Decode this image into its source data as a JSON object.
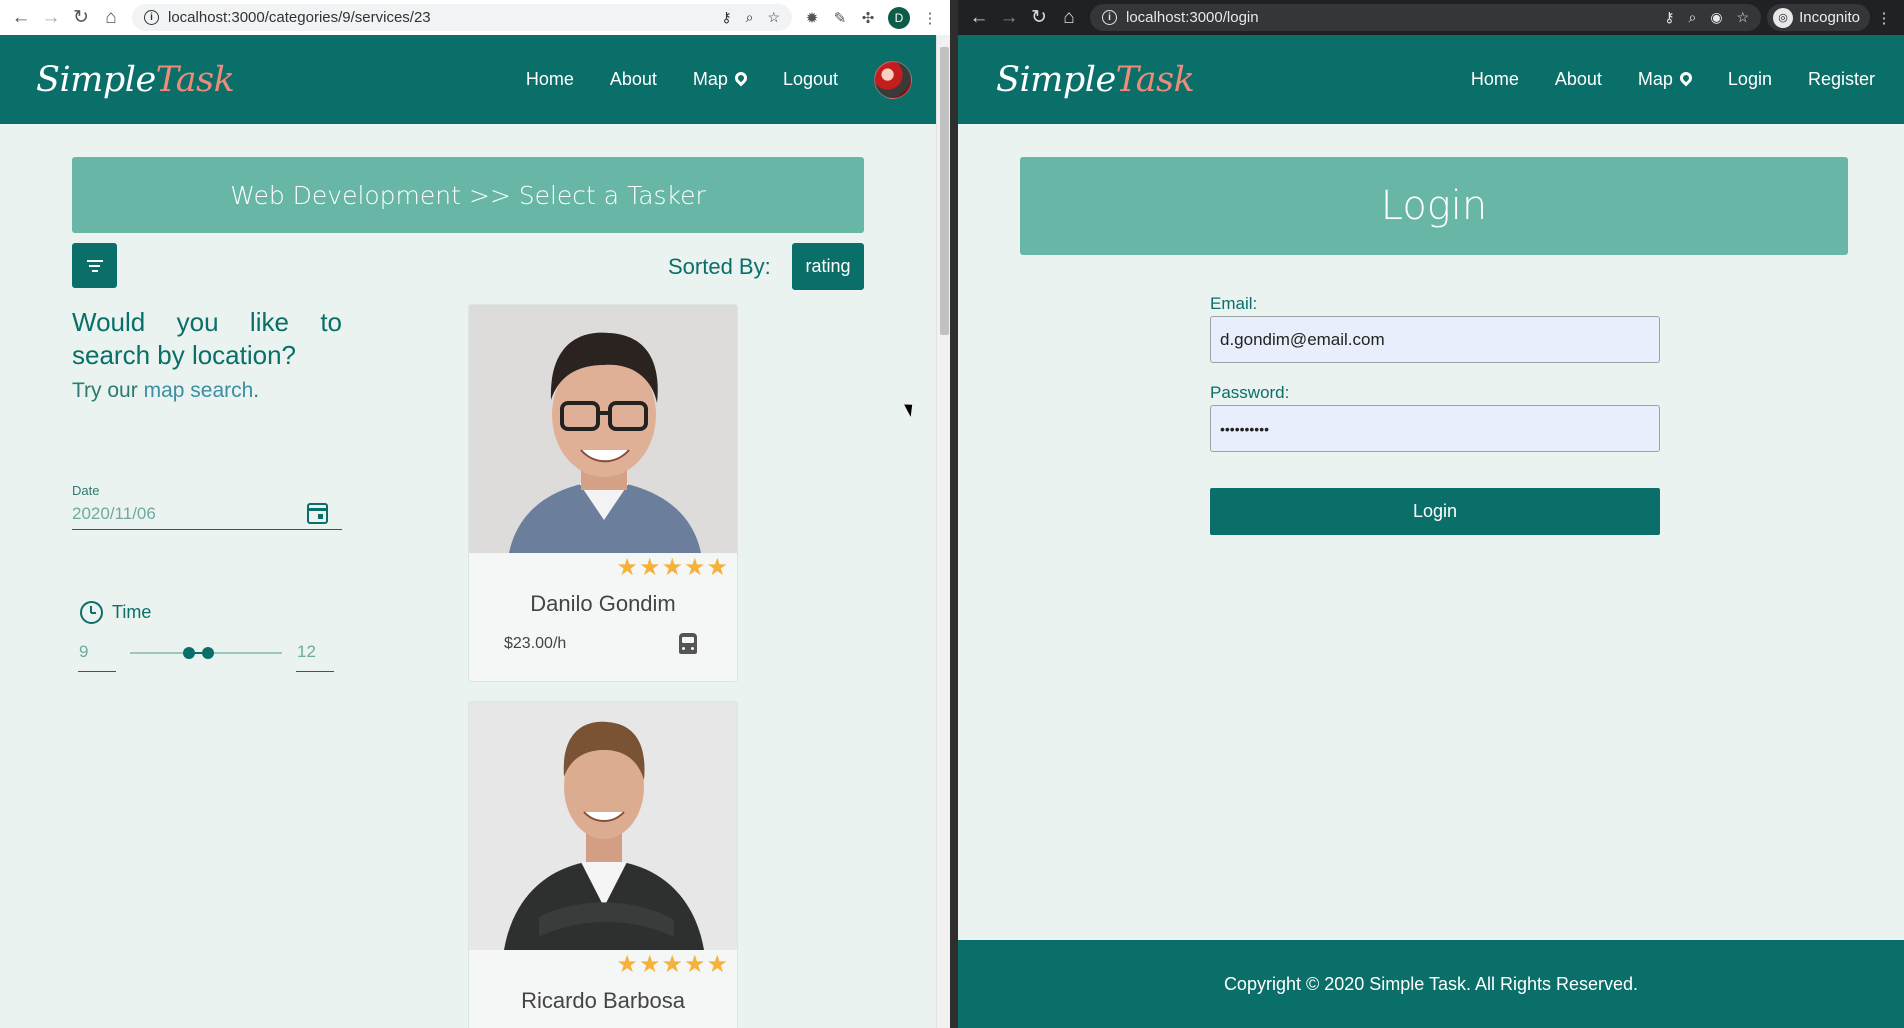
{
  "left": {
    "url": "localhost:3000/categories/9/services/23",
    "profile_initial": "D",
    "brand": {
      "part1": "Simple",
      "part2": "Task"
    },
    "nav": {
      "home": "Home",
      "about": "About",
      "map": "Map",
      "logout": "Logout"
    },
    "banner_title": "Web Development >> Select a Tasker",
    "sorted_by_label": "Sorted By:",
    "sort_value": "rating",
    "location_question": "Would you like to search by location?",
    "try_prefix": "Try our",
    "map_search_link": "map search",
    "try_suffix": ".",
    "date": {
      "label": "Date",
      "value": "2020/11/06"
    },
    "time": {
      "label": "Time",
      "from": "9",
      "to": "12",
      "range_start_fraction": 0.39,
      "range_end_fraction": 0.51
    },
    "taskers": [
      {
        "name": "Danilo Gondim",
        "rating": 5,
        "stars": "★★★★★",
        "rate": "$23.00/h",
        "vehicle_icon": "bus-icon"
      },
      {
        "name": "Ricardo Barbosa",
        "rating": 5,
        "stars": "★★★★★"
      }
    ]
  },
  "right": {
    "url": "localhost:3000/login",
    "incognito_label": "Incognito",
    "brand": {
      "part1": "Simple",
      "part2": "Task"
    },
    "nav": {
      "home": "Home",
      "about": "About",
      "map": "Map",
      "login": "Login",
      "register": "Register"
    },
    "page_title": "Login",
    "email": {
      "label": "Email:",
      "value": "d.gondim@email.com"
    },
    "password": {
      "label": "Password:",
      "masked_value": "••••••••••"
    },
    "submit_label": "Login",
    "footer": "Copyright © 2020 Simple Task. All Rights Reserved."
  },
  "colors": {
    "primary": "#0a6e69",
    "banner": "#68b7a6",
    "background": "#eaf3ef",
    "accent": "#f08a78",
    "star": "#f5b13a"
  }
}
